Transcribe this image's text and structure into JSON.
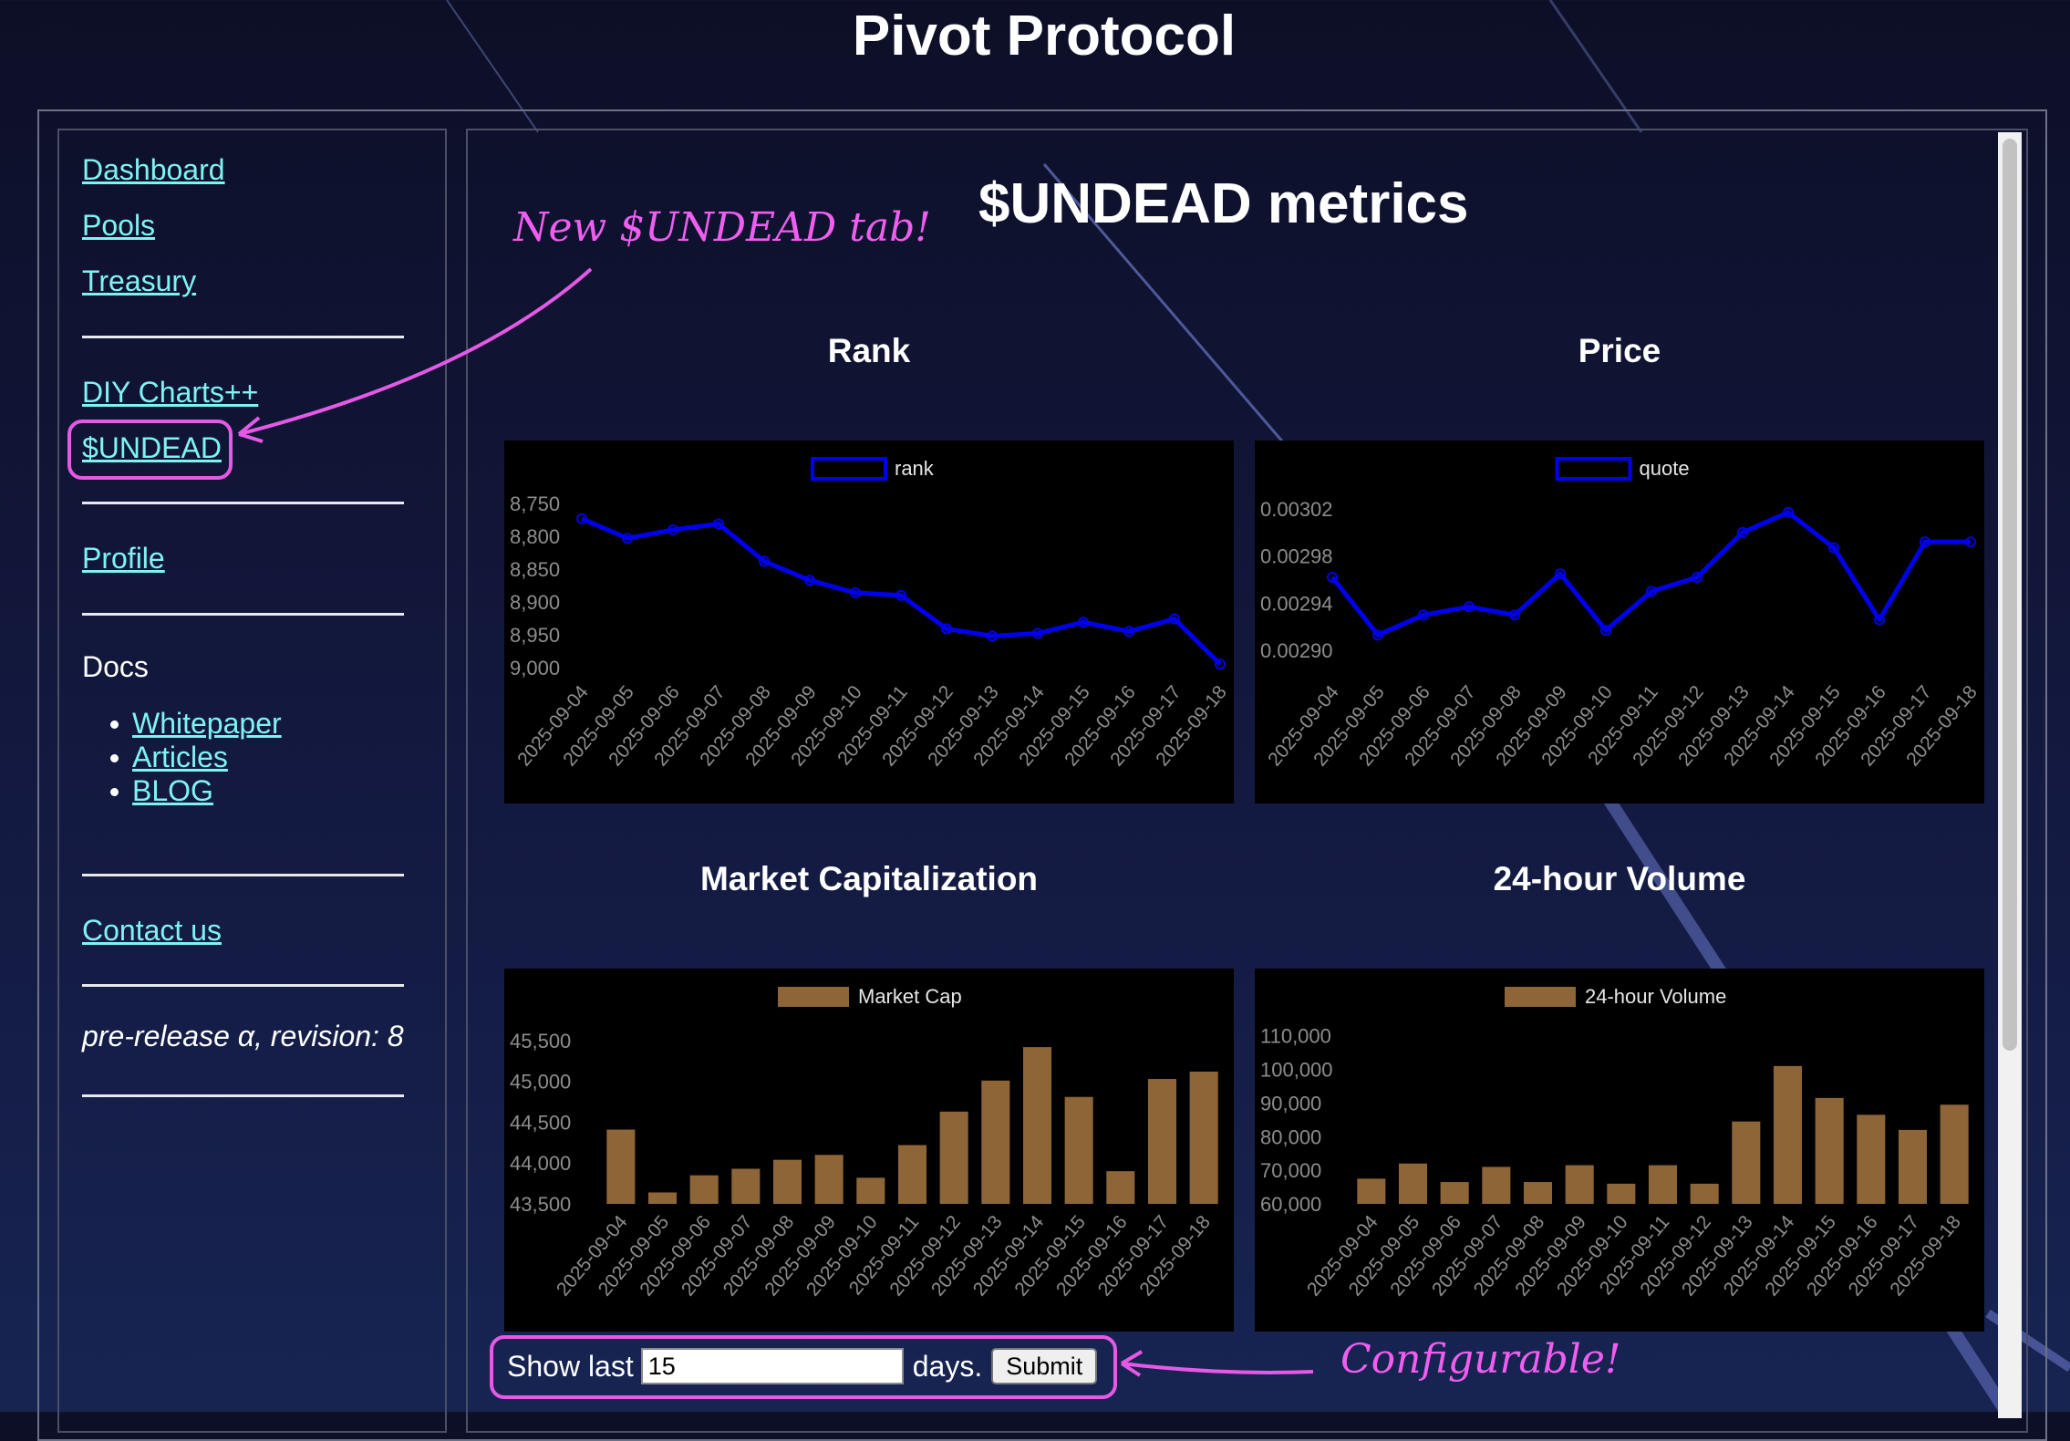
{
  "site": {
    "title": "Pivot Protocol"
  },
  "sidebar": {
    "nav": [
      {
        "label": "Dashboard"
      },
      {
        "label": "Pools"
      },
      {
        "label": "Treasury"
      },
      {
        "label": "DIY Charts++"
      },
      {
        "label": "$UNDEAD"
      },
      {
        "label": "Profile"
      },
      {
        "label": "Contact us"
      }
    ],
    "docs_heading": "Docs",
    "docs_links": [
      {
        "label": "Whitepaper"
      },
      {
        "label": "Articles"
      },
      {
        "label": "BLOG"
      }
    ],
    "version": "pre-release α, revision: 8"
  },
  "main": {
    "title": "$UNDEAD metrics"
  },
  "controls": {
    "show_label": "Show last",
    "days_value": "15",
    "days_label": "days.",
    "submit_label": "Submit"
  },
  "annotations": {
    "tab_note": "New $UNDEAD tab!",
    "config_note": "Configurable!"
  },
  "colors": {
    "line": "#0000ee",
    "bar": "#8e6537",
    "highlight": "#e659e6",
    "link": "#7ff3f3"
  },
  "chart_data": [
    {
      "id": "rank",
      "type": "line",
      "title": "Rank",
      "legend": "rank",
      "legend_placement": "top-center",
      "reverse_y": true,
      "ylim": [
        8740,
        9010
      ],
      "yticks": [
        8750,
        8800,
        8850,
        8900,
        8950,
        9000
      ],
      "ytick_labels": [
        "8,750",
        "8,800",
        "8,850",
        "8,900",
        "8,950",
        "9,000"
      ],
      "x": [
        "2025-09-04",
        "2025-09-05",
        "2025-09-06",
        "2025-09-07",
        "2025-09-08",
        "2025-09-09",
        "2025-09-10",
        "2025-09-11",
        "2025-09-12",
        "2025-09-13",
        "2025-09-14",
        "2025-09-15",
        "2025-09-16",
        "2025-09-17",
        "2025-09-18"
      ],
      "values": [
        8773,
        8803,
        8790,
        8781,
        8838,
        8867,
        8886,
        8890,
        8941,
        8952,
        8948,
        8931,
        8945,
        8926,
        8995
      ]
    },
    {
      "id": "price",
      "type": "line",
      "title": "Price",
      "legend": "quote",
      "legend_placement": "top-center",
      "ylim": [
        0.00288,
        0.00303
      ],
      "yticks": [
        0.00302,
        0.00298,
        0.00294,
        0.0029
      ],
      "ytick_labels": [
        "0.00302",
        "0.00298",
        "0.00294",
        "0.00290"
      ],
      "x": [
        "2025-09-04",
        "2025-09-05",
        "2025-09-06",
        "2025-09-07",
        "2025-09-08",
        "2025-09-09",
        "2025-09-10",
        "2025-09-11",
        "2025-09-12",
        "2025-09-13",
        "2025-09-14",
        "2025-09-15",
        "2025-09-16",
        "2025-09-17",
        "2025-09-18"
      ],
      "values": [
        0.002962,
        0.002913,
        0.00293,
        0.002937,
        0.00293,
        0.002965,
        0.002917,
        0.00295,
        0.002962,
        0.003,
        0.003017,
        0.002987,
        0.002926,
        0.002992,
        0.002992
      ]
    },
    {
      "id": "mcap",
      "type": "bar",
      "title": "Market Capitalization",
      "legend": "Market Cap",
      "legend_placement": "top-center",
      "ylim": [
        43500,
        45600
      ],
      "yticks": [
        45500,
        45000,
        44500,
        44000,
        43500
      ],
      "ytick_labels": [
        "45,500",
        "45,000",
        "44,500",
        "44,000",
        "43,500"
      ],
      "x": [
        "2025-09-04",
        "2025-09-05",
        "2025-09-06",
        "2025-09-07",
        "2025-09-08",
        "2025-09-09",
        "2025-09-10",
        "2025-09-11",
        "2025-09-12",
        "2025-09-13",
        "2025-09-14",
        "2025-09-15",
        "2025-09-16",
        "2025-09-17",
        "2025-09-18"
      ],
      "values": [
        44410,
        43640,
        43850,
        43930,
        44040,
        44100,
        43820,
        44220,
        44630,
        45010,
        45420,
        44810,
        43900,
        45030,
        45120
      ]
    },
    {
      "id": "volume",
      "type": "bar",
      "title": "24-hour Volume",
      "legend": "24-hour Volume",
      "legend_placement": "top-center",
      "ylim": [
        60000,
        111000
      ],
      "yticks": [
        110000,
        100000,
        90000,
        80000,
        70000,
        60000
      ],
      "ytick_labels": [
        "110,000",
        "100,000",
        "90,000",
        "80,000",
        "70,000",
        "60,000"
      ],
      "x": [
        "2025-09-04",
        "2025-09-05",
        "2025-09-06",
        "2025-09-07",
        "2025-09-08",
        "2025-09-09",
        "2025-09-10",
        "2025-09-11",
        "2025-09-12",
        "2025-09-13",
        "2025-09-14",
        "2025-09-15",
        "2025-09-16",
        "2025-09-17",
        "2025-09-18"
      ],
      "values": [
        67500,
        72000,
        66500,
        71000,
        66500,
        71500,
        66000,
        71500,
        66000,
        84500,
        101000,
        91500,
        86500,
        82000,
        89500
      ]
    }
  ]
}
